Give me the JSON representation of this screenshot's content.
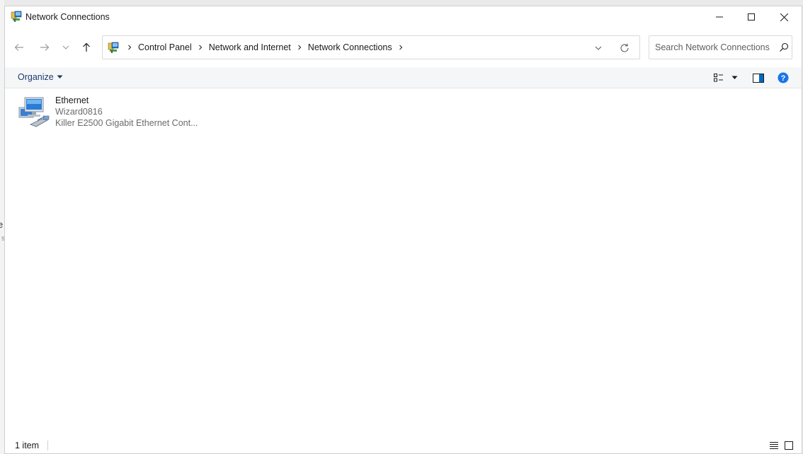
{
  "window": {
    "title": "Network Connections"
  },
  "address": {
    "crumbs": [
      "Control Panel",
      "Network and Internet",
      "Network Connections"
    ]
  },
  "search": {
    "placeholder": "Search Network Connections"
  },
  "commandbar": {
    "organize_label": "Organize"
  },
  "connections": [
    {
      "name": "Ethernet",
      "network": "Wizard0816",
      "adapter": "Killer E2500 Gigabit Ethernet Cont..."
    }
  ],
  "status": {
    "item_count": "1 item"
  },
  "background": {
    "char1": "e",
    "char2": "s"
  },
  "colors": {
    "accent_blue": "#0067c0",
    "link_text": "#1d3c6c",
    "help_blue": "#1a73e8"
  },
  "icons": {
    "app": "network-connections-icon",
    "back": "back-arrow-icon",
    "forward": "forward-arrow-icon",
    "recent": "chevron-down-icon",
    "up": "up-arrow-icon",
    "refresh": "refresh-icon",
    "search": "search-icon",
    "help": "help-icon"
  }
}
